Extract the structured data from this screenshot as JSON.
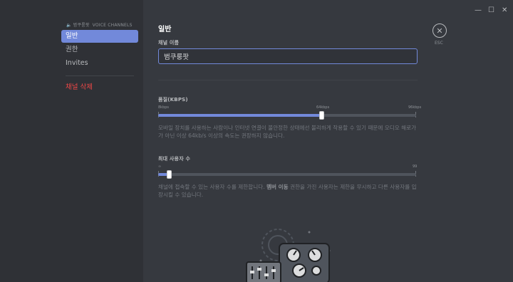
{
  "window": {
    "minimize_glyph": "—",
    "maximize_glyph": "☐",
    "close_glyph": "✕"
  },
  "sidebar": {
    "header": "범쿠룽팟",
    "header_sub": "VOICE CHANNELS",
    "items": [
      {
        "label": "일반",
        "active": true
      },
      {
        "label": "권한",
        "active": false
      },
      {
        "label": "Invites",
        "active": false
      }
    ],
    "delete_label": "채널 삭제"
  },
  "main": {
    "title": "일반",
    "name_label": "채널 이름",
    "name_value": "범쿠룽팟",
    "bitrate": {
      "label": "품질(KBPS)",
      "ticks": [
        "8kbps",
        "64kbps",
        "96kbps"
      ],
      "value_kbps": 64,
      "min_kbps": 8,
      "max_kbps": 96,
      "description": "모바일 장치를 사용하는 사람이나 인터넷 연결이 불안정한 상태에선 불리하게 작용할 수 있기 때문에 오디오 해로가가 아닌 이상 64kb/s 이상의 속도는 권장하지 않습니다."
    },
    "user_limit": {
      "label": "최대 사용자 수",
      "ticks": [
        "∞",
        "99"
      ],
      "value": 0,
      "max": 99,
      "description_before": "채널에 접속할 수 있는 사용자 수를 제한합니다.",
      "description_bold": "멤버 이동",
      "description_after": "권한을 가진 사용자는 제한을 무시하고 다른 사용자를 입장시킬 수 있습니다."
    }
  },
  "close": {
    "glyph": "✕",
    "label": "ESC"
  },
  "colors": {
    "accent": "#7289da",
    "danger": "#f04747",
    "background": "#36393f",
    "sidebar": "#2f3136"
  }
}
